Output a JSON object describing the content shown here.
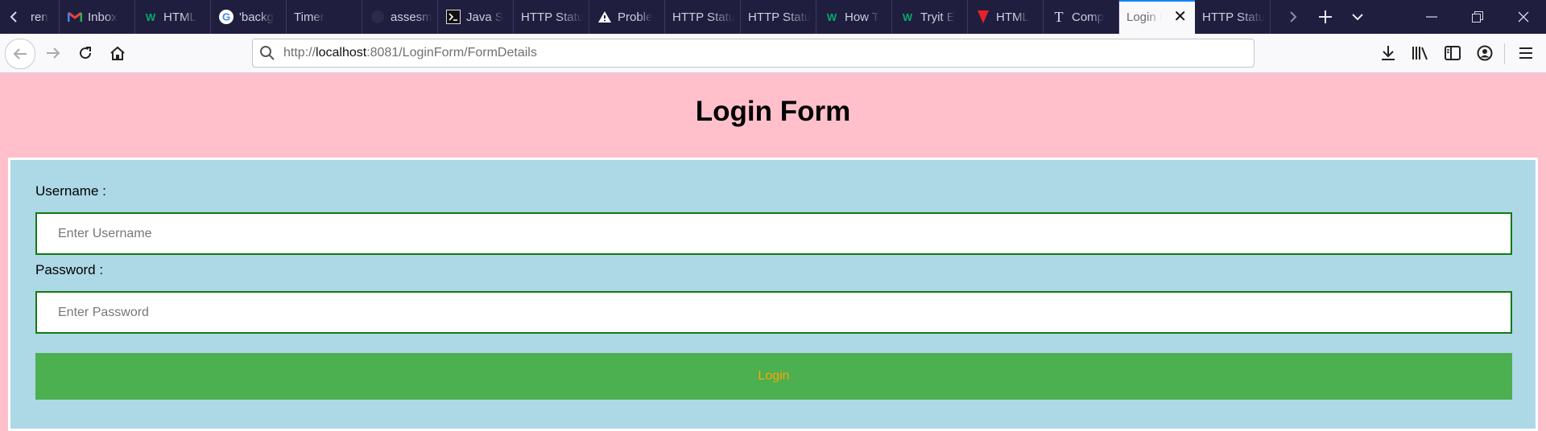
{
  "tabs": [
    {
      "label": "ren",
      "icon": "generic-page-icon"
    },
    {
      "label": "Inbox",
      "icon": "gmail-icon"
    },
    {
      "label": "HTML",
      "icon": "w3schools-icon"
    },
    {
      "label": "'backg",
      "icon": "google-icon"
    },
    {
      "label": "Timer",
      "icon": ""
    },
    {
      "label": "assesm",
      "icon": "github-icon"
    },
    {
      "label": "Java S",
      "icon": "terminal-icon"
    },
    {
      "label": "HTTP Statu",
      "icon": ""
    },
    {
      "label": "Proble",
      "icon": "warning-icon"
    },
    {
      "label": "HTTP Statu",
      "icon": ""
    },
    {
      "label": "HTTP Statu",
      "icon": ""
    },
    {
      "label": "How T",
      "icon": "w3schools-icon"
    },
    {
      "label": "Tryit E",
      "icon": "w3schools-icon"
    },
    {
      "label": "HTML",
      "icon": "tutorialspoint-icon"
    },
    {
      "label": "Comp",
      "icon": "text-t-icon"
    }
  ],
  "active_tab": {
    "label": "Login F"
  },
  "last_tab": {
    "label": "HTTP Statu"
  },
  "url": {
    "scheme": "http://",
    "host": "localhost",
    "rest": ":8081/LoginForm/FormDetails"
  },
  "page": {
    "title": "Login Form",
    "username_label": "Username :",
    "username_placeholder": "Enter Username",
    "password_label": "Password :",
    "password_placeholder": "Enter Password",
    "login_label": "Login"
  },
  "colors": {
    "page_bg": "#ffc0cb",
    "form_bg": "#add8e6",
    "input_border": "#137913",
    "button_bg": "#4caf50",
    "button_text": "#ffa500"
  }
}
